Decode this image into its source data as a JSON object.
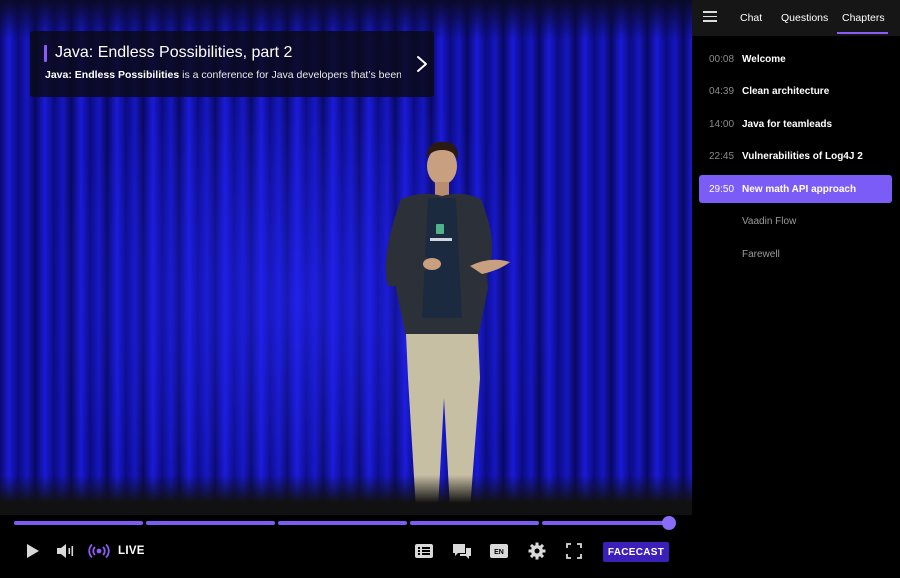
{
  "video": {
    "title": "Java: Endless Possibilities, part 2",
    "description_bold": "Java: Endless Possibilities",
    "description_rest": " is a conference for Java developers that’s been he..."
  },
  "progress": {
    "segments": 5,
    "played_fraction": 1.0
  },
  "controls": {
    "live_label": "LIVE",
    "language_badge": "EN",
    "facecast_label": "FACECAST",
    "icons": [
      "play-icon",
      "volume-icon",
      "live-broadcast-icon",
      "list-icon",
      "chat-bubbles-icon",
      "language-icon",
      "settings-gear-icon",
      "fullscreen-icon"
    ]
  },
  "panel": {
    "tabs": [
      {
        "label": "Chat"
      },
      {
        "label": "Questions"
      },
      {
        "label": "Chapters",
        "active": true
      }
    ],
    "chapters": [
      {
        "time": "00:08",
        "title": "Welcome"
      },
      {
        "time": "04:39",
        "title": "Clean architecture"
      },
      {
        "time": "14:00",
        "title": "Java for teamleads"
      },
      {
        "time": "22:45",
        "title": "Vulnerabilities of Log4J 2"
      },
      {
        "time": "29:50",
        "title": "New math API approach",
        "active": true
      },
      {
        "time": "",
        "title": "Vaadin Flow",
        "dim": true
      },
      {
        "time": "",
        "title": "Farewell",
        "dim": true
      }
    ]
  },
  "colors": {
    "accent": "#7c5cf6",
    "facecast_bg": "#3b1fb8",
    "panel_bg": "#000000",
    "header_bg": "#161616"
  }
}
